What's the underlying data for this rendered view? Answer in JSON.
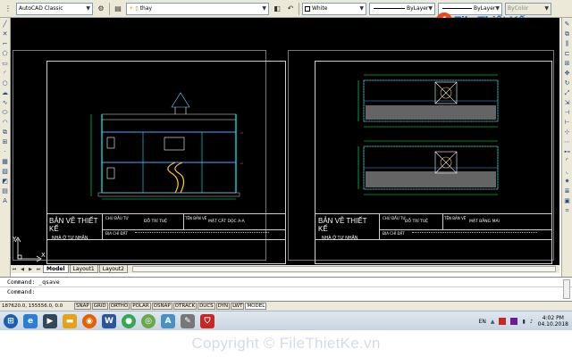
{
  "toolbar": {
    "workspace": "AutoCAD Classic",
    "layer": "thay",
    "color": "White",
    "linetype": "ByLayer",
    "lineweight": "ByLayer",
    "plotstyle": "ByColor"
  },
  "watermark": {
    "brand": "File Thiết Kế .vn"
  },
  "sheets": [
    {
      "title_main": "BẢN VẼ THIẾT KẾ",
      "title_sub": "NHÀ Ở TƯ NHÂN",
      "owner_label": "CHỦ ĐẦU TƯ",
      "owner_value": "ĐỖ TRÍ TUỆ",
      "drawing_label": "TÊN BẢN VẼ",
      "drawing_value": "MẶT CẮT DỌC A-A",
      "address_label": "ĐỊA CHỈ ĐẶT"
    },
    {
      "title_main": "BẢN VẼ THIẾT KẾ",
      "title_sub": "NHÀ Ở TƯ NHÂN",
      "owner_label": "CHỦ ĐẦU TƯ",
      "owner_value": "ĐỖ TRÍ TUỆ",
      "drawing_label": "TÊN BẢN VẼ",
      "drawing_value": "MẶT BẰNG MÁI",
      "address_label": "ĐỊA CHỈ ĐẶT"
    }
  ],
  "layout_tabs": [
    "Model",
    "Layout1",
    "Layout2"
  ],
  "active_tab": "Model",
  "command": {
    "history": "Command:  _qsave",
    "prompt": "Command:"
  },
  "status": {
    "coords": "187620.0, 155556.0, 0.0",
    "buttons": [
      "SNAP",
      "GRID",
      "ORTHO",
      "POLAR",
      "OSNAP",
      "OTRACK",
      "DUCS",
      "DYN",
      "LWT",
      "MODEL"
    ],
    "on": [
      "MODEL"
    ]
  },
  "taskbar": {
    "apps": [
      {
        "name": "windows-start-icon",
        "glyph": "⊞",
        "color": "#1a5fb4"
      },
      {
        "name": "internet-explorer-icon",
        "glyph": "e",
        "color": "#2a7fd4"
      },
      {
        "name": "media-player-icon",
        "glyph": "▶",
        "color": "#33475b"
      },
      {
        "name": "folder-icon",
        "glyph": "▬",
        "color": "#e3a21a"
      },
      {
        "name": "firefox-icon",
        "glyph": "◉",
        "color": "#e66000"
      },
      {
        "name": "word-icon",
        "glyph": "W",
        "color": "#2b579a"
      },
      {
        "name": "chrome-icon",
        "glyph": "●",
        "color": "#34a853"
      },
      {
        "name": "app-green-icon",
        "glyph": "◎",
        "color": "#6aa84f"
      },
      {
        "name": "autocad-alt-icon",
        "glyph": "A",
        "color": "#4a90c2"
      },
      {
        "name": "tool-icon",
        "glyph": "✎",
        "color": "#777777"
      },
      {
        "name": "antivirus-icon",
        "glyph": "⛉",
        "color": "#c62828"
      }
    ],
    "lang": "EN",
    "time": "4:02 PM",
    "date": "04.10.2018"
  },
  "copyright": "Copyright © FileThietKe.vn"
}
